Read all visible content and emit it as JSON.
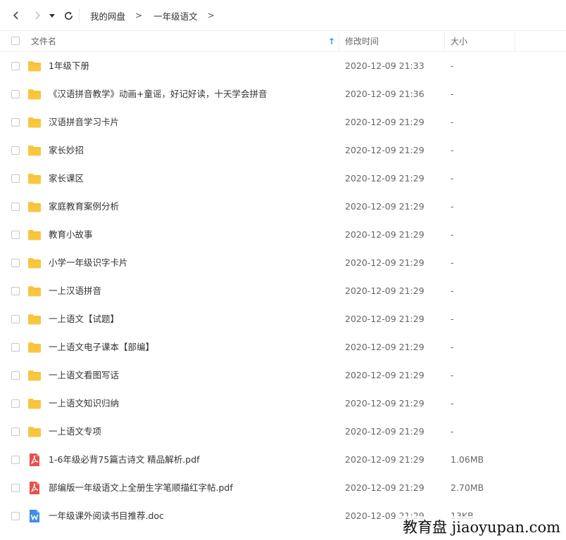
{
  "breadcrumb": {
    "items": [
      "我的网盘",
      "一年级语文"
    ],
    "separator": ">"
  },
  "table": {
    "headers": {
      "name": "文件名",
      "modified": "修改时间",
      "size": "大小"
    },
    "sort_indicator": "↑",
    "rows": [
      {
        "type": "folder",
        "name": "1年级下册",
        "modified": "2020-12-09 21:33",
        "size": "-"
      },
      {
        "type": "folder",
        "name": "《汉语拼音教学》动画+童谣，好记好读，十天学会拼音",
        "modified": "2020-12-09 21:36",
        "size": "-"
      },
      {
        "type": "folder",
        "name": "汉语拼音学习卡片",
        "modified": "2020-12-09 21:29",
        "size": "-"
      },
      {
        "type": "folder",
        "name": "家长妙招",
        "modified": "2020-12-09 21:29",
        "size": "-"
      },
      {
        "type": "folder",
        "name": "家长课区",
        "modified": "2020-12-09 21:29",
        "size": "-"
      },
      {
        "type": "folder",
        "name": "家庭教育案例分析",
        "modified": "2020-12-09 21:29",
        "size": "-"
      },
      {
        "type": "folder",
        "name": "教育小故事",
        "modified": "2020-12-09 21:29",
        "size": "-"
      },
      {
        "type": "folder",
        "name": "小学一年级识字卡片",
        "modified": "2020-12-09 21:29",
        "size": "-"
      },
      {
        "type": "folder",
        "name": "一上汉语拼音",
        "modified": "2020-12-09 21:29",
        "size": "-"
      },
      {
        "type": "folder",
        "name": "一上语文【试题】",
        "modified": "2020-12-09 21:29",
        "size": "-"
      },
      {
        "type": "folder",
        "name": "一上语文电子课本【部编】",
        "modified": "2020-12-09 21:29",
        "size": "-"
      },
      {
        "type": "folder",
        "name": "一上语文看图写话",
        "modified": "2020-12-09 21:29",
        "size": "-"
      },
      {
        "type": "folder",
        "name": "一上语文知识归纳",
        "modified": "2020-12-09 21:29",
        "size": "-"
      },
      {
        "type": "folder",
        "name": "一上语文专项",
        "modified": "2020-12-09 21:29",
        "size": "-"
      },
      {
        "type": "pdf",
        "name": "1-6年级必背75篇古诗文 精品解析.pdf",
        "modified": "2020-12-09 21:29",
        "size": "1.06MB"
      },
      {
        "type": "pdf",
        "name": "部编版一年级语文上全册生字笔顺描红字帖.pdf",
        "modified": "2020-12-09 21:29",
        "size": "2.70MB"
      },
      {
        "type": "doc",
        "name": "一年级课外阅读书目推荐.doc",
        "modified": "2020-12-09 21:29",
        "size": "13KB"
      }
    ]
  },
  "watermark": "教育盘 jiaoyupan.com",
  "colors": {
    "folder": "#f8c640",
    "pdf": "#e8504a",
    "doc": "#3c8ce7",
    "sort_arrow": "#1c9ce6"
  },
  "icons": {
    "back": "back-icon",
    "forward": "forward-icon",
    "dropdown": "caret-down-icon",
    "refresh": "refresh-icon",
    "folder": "folder-icon",
    "pdf": "pdf-icon",
    "doc": "doc-icon"
  }
}
